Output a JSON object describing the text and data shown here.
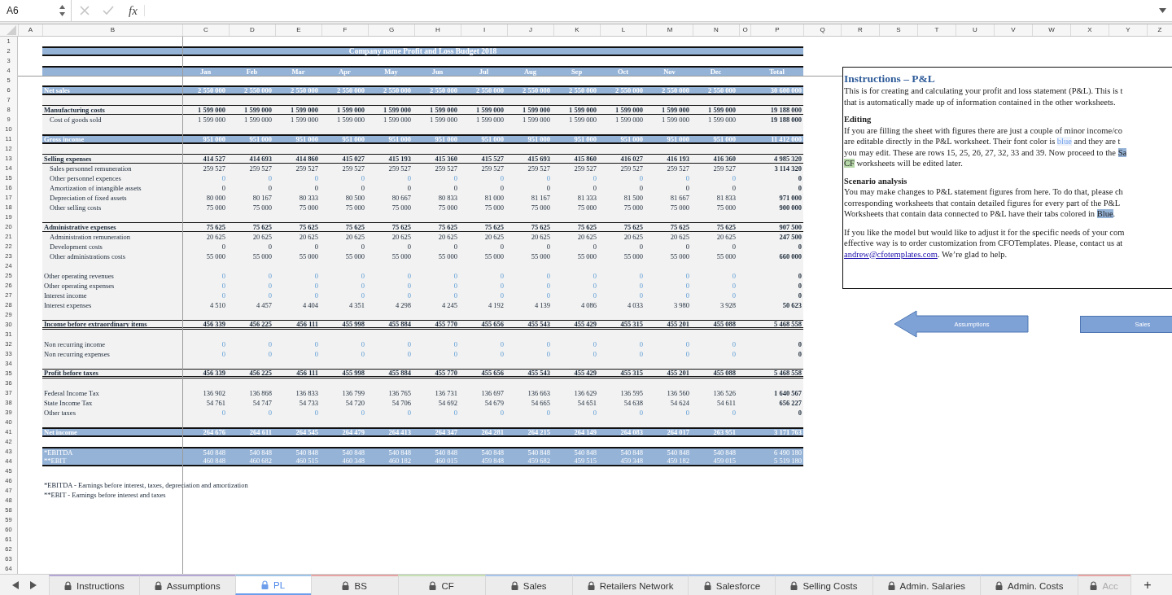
{
  "formula_bar": {
    "cell_ref": "A6",
    "function_label": "fx"
  },
  "columns": [
    "A",
    "B",
    "C",
    "D",
    "E",
    "F",
    "G",
    "H",
    "I",
    "J",
    "K",
    "L",
    "M",
    "N",
    "O",
    "P",
    "Q",
    "R",
    "S",
    "T",
    "U",
    "V",
    "W",
    "X",
    "Y",
    "Z"
  ],
  "rows": [
    {
      "number": "1"
    },
    {
      "number": "2",
      "kind": "title",
      "title": "Company name Profit and Loss Budget 2018"
    },
    {
      "number": "3"
    },
    {
      "number": "4",
      "kind": "months",
      "cells": [
        "Jan",
        "Feb",
        "Mar",
        "Apr",
        "May",
        "Jun",
        "Jul",
        "Aug",
        "Sep",
        "Oct",
        "Nov",
        "Dec",
        "Total"
      ]
    },
    {
      "number": "5"
    },
    {
      "number": "6",
      "kind": "band",
      "label": "Net sales",
      "values": [
        "2 550 000",
        "2 550 000",
        "2 550 000",
        "2 550 000",
        "2 550 000",
        "2 550 000",
        "2 550 000",
        "2 550 000",
        "2 550 000",
        "2 550 000",
        "2 550 000",
        "2 550 000",
        "30 600 000"
      ]
    },
    {
      "number": "7",
      "kind": "gap"
    },
    {
      "number": "8",
      "kind": "section",
      "label": "Manufacturing costs",
      "values": [
        "1 599 000",
        "1 599 000",
        "1 599 000",
        "1 599 000",
        "1 599 000",
        "1 599 000",
        "1 599 000",
        "1 599 000",
        "1 599 000",
        "1 599 000",
        "1 599 000",
        "1 599 000",
        "19 188 000"
      ]
    },
    {
      "number": "9",
      "kind": "item",
      "input": false,
      "label": "Cost of goods sold",
      "values": [
        "1 599 000",
        "1 599 000",
        "1 599 000",
        "1 599 000",
        "1 599 000",
        "1 599 000",
        "1 599 000",
        "1 599 000",
        "1 599 000",
        "1 599 000",
        "1 599 000",
        "1 599 000",
        "19 188 000"
      ]
    },
    {
      "number": "10",
      "kind": "gap"
    },
    {
      "number": "11",
      "kind": "band",
      "label": "Gross income",
      "values": [
        "951 000",
        "951 000",
        "951 000",
        "951 000",
        "951 000",
        "951 000",
        "951 000",
        "951 000",
        "951 000",
        "951 000",
        "951 000",
        "951 000",
        "11 412 000"
      ]
    },
    {
      "number": "12",
      "kind": "gap"
    },
    {
      "number": "13",
      "kind": "section",
      "label": "Selling expenses",
      "values": [
        "414 527",
        "414 693",
        "414 860",
        "415 027",
        "415 193",
        "415 360",
        "415 527",
        "415 693",
        "415 860",
        "416 027",
        "416 193",
        "416 360",
        "4 985 320"
      ]
    },
    {
      "number": "14",
      "kind": "item",
      "input": false,
      "label": "Sales personnel remuneration",
      "values": [
        "259 527",
        "259 527",
        "259 527",
        "259 527",
        "259 527",
        "259 527",
        "259 527",
        "259 527",
        "259 527",
        "259 527",
        "259 527",
        "259 527",
        "3 114 320"
      ]
    },
    {
      "number": "15",
      "kind": "item",
      "input": true,
      "label": "Other personnel expences",
      "values": [
        "0",
        "0",
        "0",
        "0",
        "0",
        "0",
        "0",
        "0",
        "0",
        "0",
        "0",
        "0",
        "0"
      ]
    },
    {
      "number": "16",
      "kind": "item",
      "input": false,
      "label": "Amortization of intangible assets",
      "values": [
        "0",
        "0",
        "0",
        "0",
        "0",
        "0",
        "0",
        "0",
        "0",
        "0",
        "0",
        "0",
        "0"
      ]
    },
    {
      "number": "17",
      "kind": "item",
      "input": false,
      "label": "Depreciation of fixed assets",
      "values": [
        "80 000",
        "80 167",
        "80 333",
        "80 500",
        "80 667",
        "80 833",
        "81 000",
        "81 167",
        "81 333",
        "81 500",
        "81 667",
        "81 833",
        "971 000"
      ]
    },
    {
      "number": "18",
      "kind": "item",
      "input": false,
      "label": "Other selling costs",
      "values": [
        "75 000",
        "75 000",
        "75 000",
        "75 000",
        "75 000",
        "75 000",
        "75 000",
        "75 000",
        "75 000",
        "75 000",
        "75 000",
        "75 000",
        "900 000"
      ]
    },
    {
      "number": "19",
      "kind": "gap"
    },
    {
      "number": "20",
      "kind": "section",
      "label": "Administrative expenses",
      "values": [
        "75 625",
        "75 625",
        "75 625",
        "75 625",
        "75 625",
        "75 625",
        "75 625",
        "75 625",
        "75 625",
        "75 625",
        "75 625",
        "75 625",
        "907 500"
      ]
    },
    {
      "number": "21",
      "kind": "item",
      "input": false,
      "label": "Administration remuneration",
      "values": [
        "20 625",
        "20 625",
        "20 625",
        "20 625",
        "20 625",
        "20 625",
        "20 625",
        "20 625",
        "20 625",
        "20 625",
        "20 625",
        "20 625",
        "247 500"
      ]
    },
    {
      "number": "22",
      "kind": "item",
      "input": false,
      "label": "Development costs",
      "values": [
        "0",
        "0",
        "0",
        "0",
        "0",
        "0",
        "0",
        "0",
        "0",
        "0",
        "0",
        "0",
        "0"
      ]
    },
    {
      "number": "23",
      "kind": "item",
      "input": false,
      "label": "Other administrations costs",
      "values": [
        "55 000",
        "55 000",
        "55 000",
        "55 000",
        "55 000",
        "55 000",
        "55 000",
        "55 000",
        "55 000",
        "55 000",
        "55 000",
        "55 000",
        "660 000"
      ]
    },
    {
      "number": "24",
      "kind": "gap"
    },
    {
      "number": "25",
      "kind": "plain",
      "input": true,
      "label": "Other operating revenues",
      "values": [
        "0",
        "0",
        "0",
        "0",
        "0",
        "0",
        "0",
        "0",
        "0",
        "0",
        "0",
        "0",
        "0"
      ]
    },
    {
      "number": "26",
      "kind": "plain",
      "input": true,
      "label": "Other operating expenses",
      "values": [
        "0",
        "0",
        "0",
        "0",
        "0",
        "0",
        "0",
        "0",
        "0",
        "0",
        "0",
        "0",
        "0"
      ]
    },
    {
      "number": "27",
      "kind": "plain",
      "input": true,
      "label": "Interest income",
      "values": [
        "0",
        "0",
        "0",
        "0",
        "0",
        "0",
        "0",
        "0",
        "0",
        "0",
        "0",
        "0",
        "0"
      ]
    },
    {
      "number": "28",
      "kind": "plain",
      "input": false,
      "label": "Interest expenses",
      "values": [
        "4 510",
        "4 457",
        "4 404",
        "4 351",
        "4 298",
        "4 245",
        "4 192",
        "4 139",
        "4 086",
        "4 033",
        "3 980",
        "3 928",
        "50 623"
      ]
    },
    {
      "number": "29",
      "kind": "gap"
    },
    {
      "number": "30",
      "kind": "total",
      "label": "Income before extraordinary items",
      "values": [
        "456 339",
        "456 225",
        "456 111",
        "455 998",
        "455 884",
        "455 770",
        "455 656",
        "455 543",
        "455 429",
        "455 315",
        "455 201",
        "455 088",
        "5 468 558"
      ]
    },
    {
      "number": "31",
      "kind": "gap"
    },
    {
      "number": "32",
      "kind": "plain",
      "input": true,
      "label": "Non recurring income",
      "values": [
        "0",
        "0",
        "0",
        "0",
        "0",
        "0",
        "0",
        "0",
        "0",
        "0",
        "0",
        "0",
        "0"
      ]
    },
    {
      "number": "33",
      "kind": "plain",
      "input": true,
      "label": "Non recurring expenses",
      "values": [
        "0",
        "0",
        "0",
        "0",
        "0",
        "0",
        "0",
        "0",
        "0",
        "0",
        "0",
        "0",
        "0"
      ]
    },
    {
      "number": "34",
      "kind": "gap"
    },
    {
      "number": "35",
      "kind": "total",
      "label": "Profit before taxes",
      "values": [
        "456 339",
        "456 225",
        "456 111",
        "455 998",
        "455 884",
        "455 770",
        "455 656",
        "455 543",
        "455 429",
        "455 315",
        "455 201",
        "455 088",
        "5 468 558"
      ]
    },
    {
      "number": "36",
      "kind": "gap"
    },
    {
      "number": "37",
      "kind": "plain",
      "input": false,
      "label": "Federal Income Tax",
      "values": [
        "136 902",
        "136 868",
        "136 833",
        "136 799",
        "136 765",
        "136 731",
        "136 697",
        "136 663",
        "136 629",
        "136 595",
        "136 560",
        "136 526",
        "1 640 567"
      ]
    },
    {
      "number": "38",
      "kind": "plain",
      "input": false,
      "label": "State Income Tax",
      "values": [
        "54 761",
        "54 747",
        "54 733",
        "54 720",
        "54 706",
        "54 692",
        "54 679",
        "54 665",
        "54 651",
        "54 638",
        "54 624",
        "54 611",
        "656 227"
      ]
    },
    {
      "number": "39",
      "kind": "plain",
      "input": true,
      "label": "Other taxes",
      "values": [
        "0",
        "0",
        "0",
        "0",
        "0",
        "0",
        "0",
        "0",
        "0",
        "0",
        "0",
        "0",
        "0"
      ]
    },
    {
      "number": "40",
      "kind": "gap"
    },
    {
      "number": "41",
      "kind": "band",
      "label": "Net income",
      "values": [
        "264 676",
        "264 611",
        "264 545",
        "264 479",
        "264 413",
        "264 347",
        "264 281",
        "264 215",
        "264 149",
        "264 083",
        "264 017",
        "263 951",
        "3 171 763"
      ]
    },
    {
      "number": "42"
    },
    {
      "number": "43",
      "kind": "metric",
      "label": "*EBITDA",
      "values": [
        "540 848",
        "540 848",
        "540 848",
        "540 848",
        "540 848",
        "540 848",
        "540 848",
        "540 848",
        "540 848",
        "540 848",
        "540 848",
        "540 848",
        "6 490 180"
      ]
    },
    {
      "number": "44",
      "kind": "metric",
      "label": "**EBIT",
      "values": [
        "460 848",
        "460 682",
        "460 515",
        "460 348",
        "460 182",
        "460 015",
        "459 848",
        "459 682",
        "459 515",
        "459 348",
        "459 182",
        "459 015",
        "5 519 180"
      ]
    },
    {
      "number": "45"
    },
    {
      "number": "46",
      "kind": "note",
      "text": "*EBITDA - Earnings before interest, taxes, depreciation and amortization"
    },
    {
      "number": "47",
      "kind": "note",
      "text": "**EBIT - Earnings before interest and taxes"
    },
    {
      "number": "48"
    },
    {
      "number": "58"
    },
    {
      "number": "59"
    },
    {
      "number": "60"
    },
    {
      "number": "61"
    },
    {
      "number": "62"
    },
    {
      "number": "63"
    },
    {
      "number": "64"
    }
  ],
  "instructions": {
    "title": "Instructions – P&L",
    "blocks": [
      {
        "kind": "paragraph",
        "lines": [
          [
            {
              "kind": "plain",
              "text": "This is for creating and calculating your profit and loss statement (P&L). This is t"
            }
          ],
          [
            {
              "kind": "plain",
              "text": "that is automatically made up of information contained in the other worksheets."
            }
          ]
        ]
      },
      {
        "kind": "heading",
        "text": "Editing"
      },
      {
        "kind": "paragraph",
        "lines": [
          [
            {
              "kind": "plain",
              "text": "If you are filling the sheet with figures there are just a couple of minor income/co"
            }
          ],
          [
            {
              "kind": "plain",
              "text": "are editable directly in the P&L worksheet. Their font color is "
            },
            {
              "kind": "blue",
              "text": "blue"
            },
            {
              "kind": "plain",
              "text": " and they are t"
            }
          ],
          [
            {
              "kind": "plain",
              "text": "you may edit. These are rows 15, 25, 26, 27, 32, 33 and 39. Now proceed to the "
            },
            {
              "kind": "blue-tab",
              "text": "Sa"
            }
          ],
          [
            {
              "kind": "green-tab",
              "text": "CF"
            },
            {
              "kind": "plain",
              "text": " worksheets will be edited later."
            }
          ]
        ]
      },
      {
        "kind": "heading",
        "text": "Scenario analysis"
      },
      {
        "kind": "paragraph",
        "lines": [
          [
            {
              "kind": "plain",
              "text": "You may make changes to P&L statement figures from here. To do that, please ch"
            }
          ],
          [
            {
              "kind": "plain",
              "text": "corresponding worksheets that contain detailed figures for every part of the P&L"
            }
          ],
          [
            {
              "kind": "plain",
              "text": "Worksheets that contain data connected to P&L have their tabs colored in "
            },
            {
              "kind": "blue-tab",
              "text": "Blue"
            },
            {
              "kind": "plain",
              "text": "."
            }
          ]
        ]
      },
      {
        "kind": "paragraph",
        "lines": [
          [
            {
              "kind": "plain",
              "text": "If you like the model but would like to adjust it for the specific needs of your com"
            }
          ],
          [
            {
              "kind": "plain",
              "text": "effective way is to order customization from CFOTemplates. Please, contact us at"
            }
          ],
          [
            {
              "kind": "link",
              "text": "andrew@cfotemplates.com"
            },
            {
              "kind": "plain",
              "text": ". We’re glad to help."
            }
          ]
        ]
      }
    ]
  },
  "nav_buttons": [
    {
      "kind": "arrow",
      "label": "Assumptions"
    },
    {
      "kind": "box",
      "label": "Sales"
    }
  ],
  "sheet_tabs": [
    {
      "label": "Instructions",
      "color": "#b4a7d6",
      "selected": false
    },
    {
      "label": "Assumptions",
      "color": "#b4a7d6",
      "selected": false
    },
    {
      "label": "PL",
      "color": "#9fc5e8",
      "selected": true
    },
    {
      "label": "BS",
      "color": "#e6a3a3",
      "selected": false
    },
    {
      "label": "CF",
      "color": "#c6e0b4",
      "selected": false
    },
    {
      "label": "Sales",
      "color": "#a9c4eb",
      "selected": false
    },
    {
      "label": "Retailers Network",
      "color": "#a9c4eb",
      "selected": false
    },
    {
      "label": "Salesforce",
      "color": "#a9c4eb",
      "selected": false
    },
    {
      "label": "Selling Costs",
      "color": "#a9c4eb",
      "selected": false
    },
    {
      "label": "Admin. Salaries",
      "color": "#a9c4eb",
      "selected": false
    },
    {
      "label": "Admin. Costs",
      "color": "#a9c4eb",
      "selected": false
    },
    {
      "label": "Acc",
      "color": "#e6a3a3",
      "selected": false
    }
  ],
  "add_sheet": "+"
}
